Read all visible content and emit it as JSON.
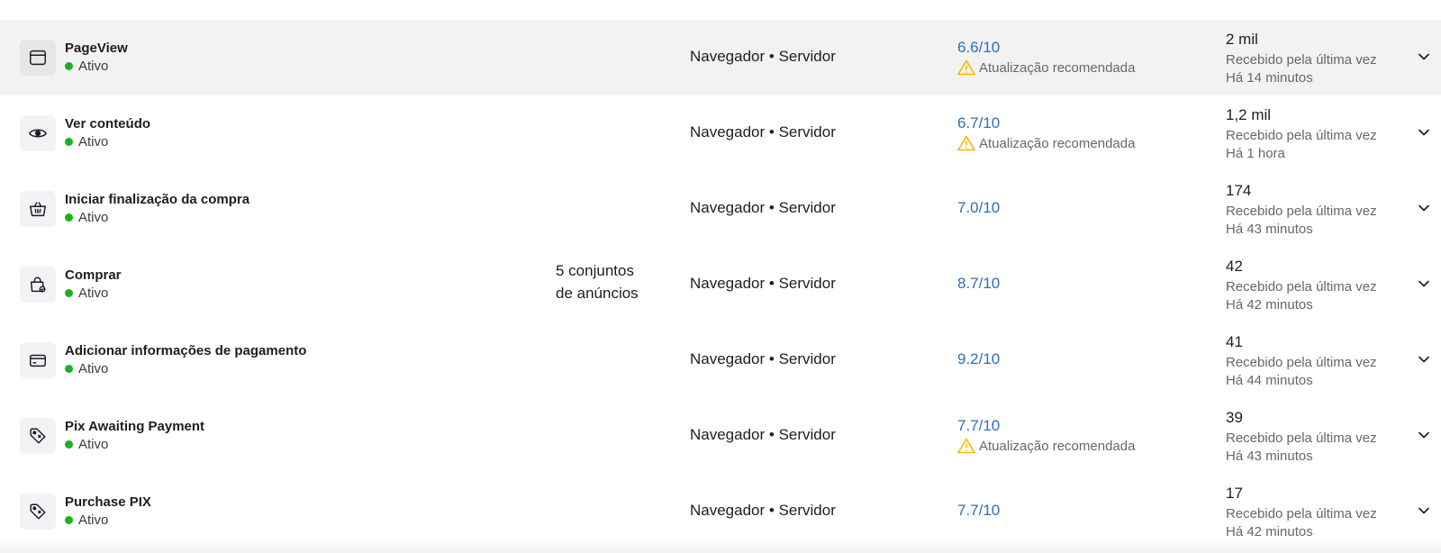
{
  "rows": [
    {
      "name": "PageView",
      "status": "Ativo",
      "icon": "browser-window-icon",
      "adsets": "",
      "source": "Navegador • Servidor",
      "score": "6.6/10",
      "warning": "Atualização recomendada",
      "count": "2 mil",
      "received_line1": "Recebido pela última vez",
      "received_line2": "Há 14 minutos",
      "highlight": true
    },
    {
      "name": "Ver conteúdo",
      "status": "Ativo",
      "icon": "eye-icon",
      "adsets": "",
      "source": "Navegador • Servidor",
      "score": "6.7/10",
      "warning": "Atualização recomendada",
      "count": "1,2 mil",
      "received_line1": "Recebido pela última vez",
      "received_line2": "Há 1 hora"
    },
    {
      "name": "Iniciar finalização da compra",
      "status": "Ativo",
      "icon": "basket-icon",
      "adsets": "",
      "source": "Navegador • Servidor",
      "score": "7.0/10",
      "warning": "",
      "count": "174",
      "received_line1": "Recebido pela última vez",
      "received_line2": "Há 43 minutos"
    },
    {
      "name": "Comprar",
      "status": "Ativo",
      "icon": "shopping-bag-icon",
      "adsets_line1": "5 conjuntos",
      "adsets_line2": "de anúncios",
      "source": "Navegador • Servidor",
      "score": "8.7/10",
      "warning": "",
      "count": "42",
      "received_line1": "Recebido pela última vez",
      "received_line2": "Há 42 minutos"
    },
    {
      "name": "Adicionar informações de pagamento",
      "status": "Ativo",
      "icon": "credit-card-icon",
      "adsets": "",
      "source": "Navegador • Servidor",
      "score": "9.2/10",
      "warning": "",
      "count": "41",
      "received_line1": "Recebido pela última vez",
      "received_line2": "Há 44 minutos"
    },
    {
      "name": "Pix Awaiting Payment",
      "status": "Ativo",
      "icon": "tag-icon",
      "adsets": "",
      "source": "Navegador • Servidor",
      "score": "7.7/10",
      "warning": "Atualização recomendada",
      "count": "39",
      "received_line1": "Recebido pela última vez",
      "received_line2": "Há 43 minutos"
    },
    {
      "name": "Purchase PIX",
      "status": "Ativo",
      "icon": "tag-icon",
      "adsets": "",
      "source": "Navegador • Servidor",
      "score": "7.7/10",
      "warning": "",
      "count": "17",
      "received_line1": "Recebido pela última vez",
      "received_line2": "Há 42 minutos"
    }
  ],
  "colors": {
    "active_dot": "#1db021",
    "score_link": "#2a6fba",
    "warning": "#f5b800",
    "highlight_row": "#f2f2f2"
  }
}
